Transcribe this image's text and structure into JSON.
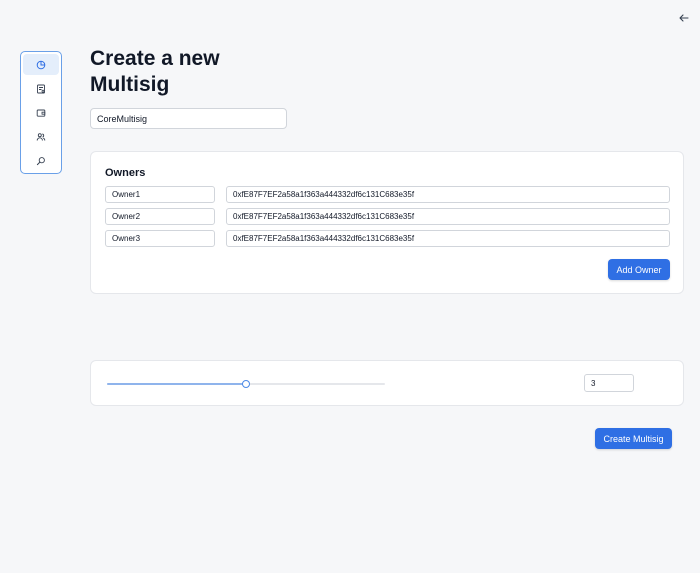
{
  "header": {
    "back_icon": "arrow-left-icon"
  },
  "sidebar": {
    "items": [
      {
        "icon": "pie-chart-icon",
        "active": true
      },
      {
        "icon": "document-icon",
        "active": false
      },
      {
        "icon": "wallet-icon",
        "active": false
      },
      {
        "icon": "users-icon",
        "active": false
      },
      {
        "icon": "search-icon",
        "active": false
      }
    ]
  },
  "page": {
    "title_line1": "Create a new",
    "title_line2": "Multisig",
    "multisig_name": "CoreMultisig"
  },
  "owners": {
    "heading": "Owners",
    "rows": [
      {
        "name": "Owner1",
        "address": "0xfE87F7EF2a58a1f363a444332df6c131C683e35f"
      },
      {
        "name": "Owner2",
        "address": "0xfE87F7EF2a58a1f363a444332df6c131C683e35f"
      },
      {
        "name": "Owner3",
        "address": "0xfE87F7EF2a58a1f363a444332df6c131C683e35f"
      }
    ],
    "add_button_label": "Add Owner"
  },
  "threshold": {
    "value": "3",
    "slider_fraction": 0.5
  },
  "actions": {
    "create_button_label": "Create Multisig"
  },
  "colors": {
    "accent": "#2f6fe4",
    "sidebar_border": "#6aa0e8",
    "active_bg": "#e4eefb"
  }
}
